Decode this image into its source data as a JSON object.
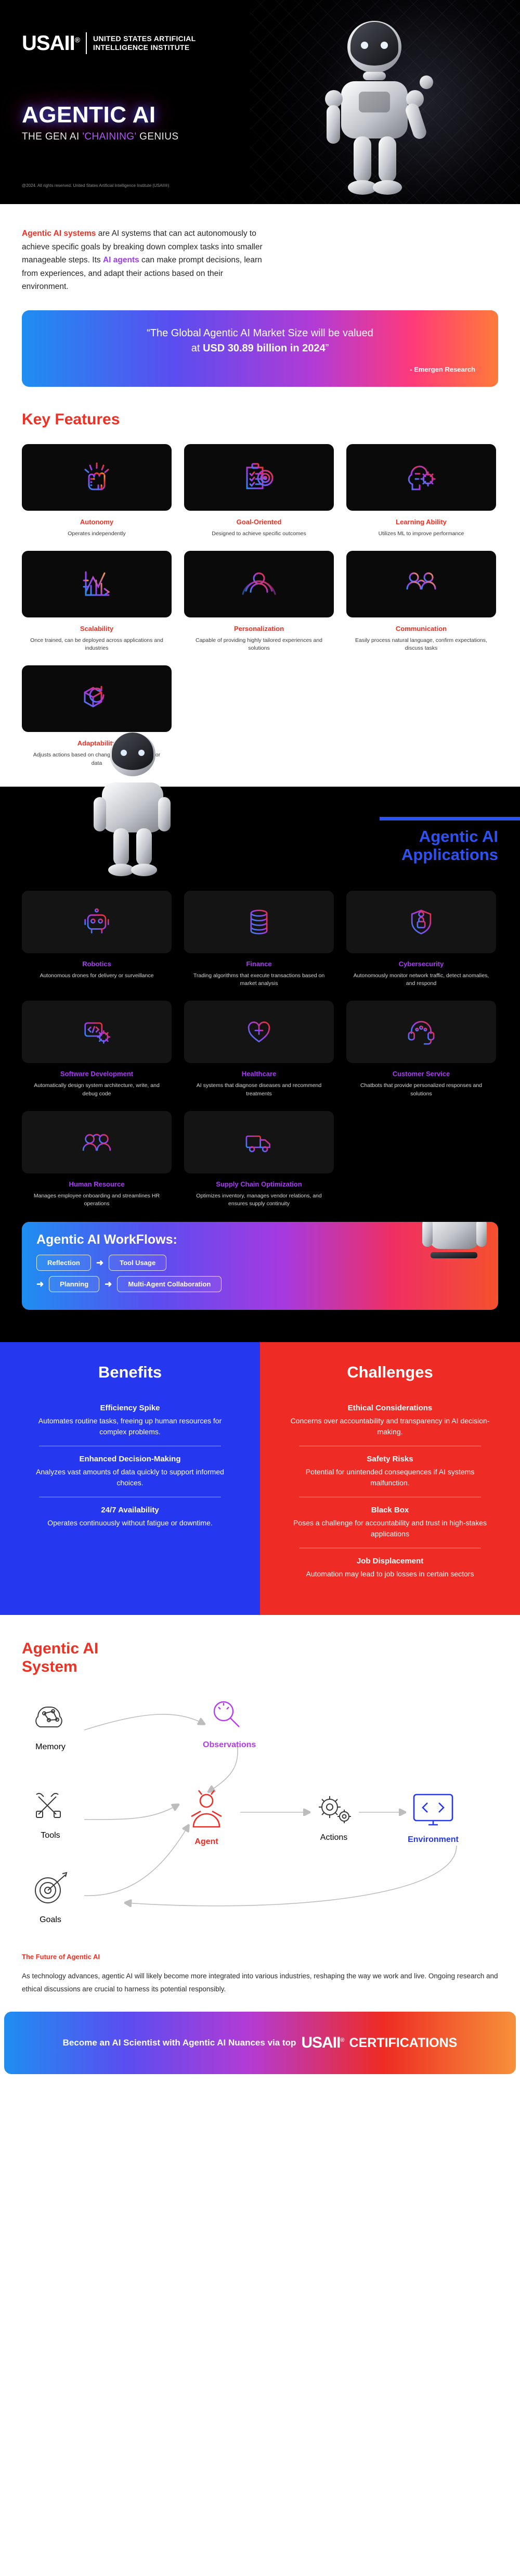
{
  "brand": {
    "logo_mark": "USAII",
    "logo_registered": "®",
    "logo_line1": "UNITED STATES ARTIFICIAL",
    "logo_line2": "INTELLIGENCE INSTITUTE"
  },
  "hero": {
    "title": "AGENTIC AI",
    "subtitle_plain": "THE GEN AI ",
    "subtitle_highlight": "'CHAINING'",
    "subtitle_tail": " GENIUS",
    "copyright": "@2024. All rights reserved. United States Artificial Intelligence Institute (USAII®)"
  },
  "intro": {
    "lead": "Agentic AI systems",
    "body1": " are AI systems that can act autonomously to achieve specific goals by breaking down complex tasks into smaller manageable steps. Its ",
    "lead2": "AI agents",
    "body2": " can make prompt decisions, learn from experiences, and adapt their actions based on their environment."
  },
  "quote": {
    "line1": "“The Global Agentic AI Market Size will be valued",
    "line2_pre": "at ",
    "line2_bold": "USD 30.89 billion in 2024",
    "line2_post": "”",
    "source": "- Emergen Research"
  },
  "key_features": {
    "heading": "Key Features",
    "items": [
      {
        "icon": "fist-icon",
        "title": "Autonomy",
        "desc": "Operates independently"
      },
      {
        "icon": "target-clipboard-icon",
        "title": "Goal-Oriented",
        "desc": "Designed to achieve specific outcomes"
      },
      {
        "icon": "brain-gear-icon",
        "title": "Learning Ability",
        "desc": "Utilizes ML to improve performance"
      },
      {
        "icon": "growth-chart-icon",
        "title": "Scalability",
        "desc": "Once trained, can be deployed across applications and industries"
      },
      {
        "icon": "user-target-icon",
        "title": "Personalization",
        "desc": "Capable of providing highly tailored experiences and solutions"
      },
      {
        "icon": "chat-bubbles-icon",
        "title": "Communication",
        "desc": "Easily process natural language, confirm expectations, discuss tasks"
      },
      {
        "icon": "cube-refresh-icon",
        "title": "Adaptability",
        "desc": "Adjusts actions based on changing circumstances or data"
      }
    ]
  },
  "applications": {
    "heading_line1": "Agentic AI",
    "heading_line2": "Applications",
    "items": [
      {
        "icon": "robot-icon",
        "title": "Robotics",
        "desc": "Autonomous drones for delivery or surveillance"
      },
      {
        "icon": "finance-coins-icon",
        "title": "Finance",
        "desc": "Trading algorithms that execute transactions based on market analysis"
      },
      {
        "icon": "shield-lock-icon",
        "title": "Cybersecurity",
        "desc": "Autonomously monitor network traffic, detect anomalies, and respond"
      },
      {
        "icon": "code-gear-icon",
        "title": "Software Development",
        "desc": "Automatically design system architecture, write, and debug code"
      },
      {
        "icon": "heart-medical-icon",
        "title": "Healthcare",
        "desc": "AI systems that diagnose diseases and recommend treatments"
      },
      {
        "icon": "headset-support-icon",
        "title": "Customer Service",
        "desc": "Chatbots that provide personalized responses and solutions"
      },
      {
        "icon": "people-chat-icon",
        "title": "Human Resource",
        "desc": "Manages employee onboarding and streamlines HR operations"
      },
      {
        "icon": "truck-delivery-icon",
        "title": "Supply Chain Optimization",
        "desc": "Optimizes inventory, manages vendor relations, and ensures supply continuity"
      }
    ]
  },
  "workflows": {
    "heading": "Agentic AI WorkFlows:",
    "steps": [
      "Reflection",
      "Tool Usage",
      "Planning",
      "Multi-Agent Collaboration"
    ],
    "arrow": "➜"
  },
  "benefits": {
    "heading": "Benefits",
    "items": [
      {
        "title": "Efficiency Spike",
        "desc": "Automates routine tasks, freeing up human resources for complex problems."
      },
      {
        "title": "Enhanced Decision-Making",
        "desc": "Analyzes vast amounts of data quickly to support informed choices."
      },
      {
        "title": "24/7 Availability",
        "desc": "Operates continuously without fatigue or downtime."
      }
    ]
  },
  "challenges": {
    "heading": "Challenges",
    "items": [
      {
        "title": "Ethical Considerations",
        "desc": "Concerns over accountability and transparency in AI decision-making."
      },
      {
        "title": "Safety Risks",
        "desc": "Potential for unintended consequences if AI systems malfunction."
      },
      {
        "title": "Black Box",
        "desc": "Poses a challenge for accountability and trust in high-stakes applications"
      },
      {
        "title": "Job Displacement",
        "desc": "Automation may lead to job losses in certain sectors"
      }
    ]
  },
  "system": {
    "heading_line1": "Agentic AI",
    "heading_line2": "System",
    "nodes": [
      {
        "id": "memory",
        "label": "Memory",
        "icon": "brain-network-icon",
        "color": "#3a3a3a"
      },
      {
        "id": "observations",
        "label": "Observations",
        "icon": "magnifier-icon",
        "color": "#b33cf0"
      },
      {
        "id": "tools",
        "label": "Tools",
        "icon": "tools-icon",
        "color": "#3a3a3a"
      },
      {
        "id": "agent",
        "label": "Agent",
        "icon": "agent-person-icon",
        "color": "#ee2b24"
      },
      {
        "id": "actions",
        "label": "Actions",
        "icon": "gear-cluster-icon",
        "color": "#3a3a3a"
      },
      {
        "id": "environment",
        "label": "Environment",
        "icon": "monitor-code-icon",
        "color": "#2538f0"
      },
      {
        "id": "goals",
        "label": "Goals",
        "icon": "bullseye-icon",
        "color": "#3a3a3a"
      }
    ]
  },
  "future": {
    "heading": "The Future of Agentic AI",
    "body": "As technology advances, agentic AI will likely become more integrated into various industries, reshaping the way we work and live. Ongoing research and ethical discussions are crucial to harness its potential responsibly."
  },
  "footer": {
    "text": "Become an AI Scientist with Agentic AI Nuances via top",
    "logo": "USAII",
    "logo_registered": "®",
    "cta": "CERTIFICATIONS"
  },
  "colors": {
    "red": "#ef3124",
    "purple": "#a93bf5",
    "blue": "#2538f0",
    "black": "#000000"
  }
}
